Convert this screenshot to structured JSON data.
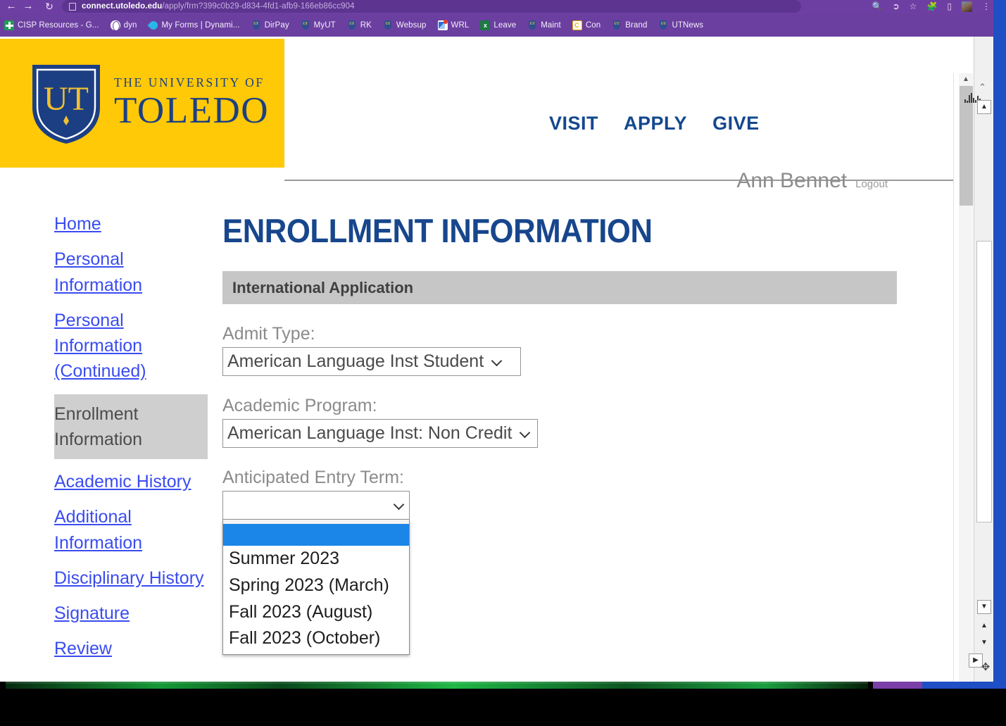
{
  "browser": {
    "nav": {
      "back_icon": "back-arrow-icon",
      "forward_icon": "forward-arrow-icon",
      "reload_icon": "reload-icon"
    },
    "url_host": "connect.utoledo.edu",
    "url_path": "/apply/frm?399c0b29-d834-4fd1-afb9-166eb86cc904",
    "toolbar_icons": [
      "search-icon",
      "share-icon",
      "bookmark-star-icon",
      "extensions-puzzle-icon",
      "sidebar-panel-icon",
      "profile-avatar",
      "browser-menu-icon"
    ],
    "bookmarks": [
      {
        "label": "CISP Resources - G...",
        "icon": "cross-icon"
      },
      {
        "label": "dyn",
        "icon": "globe-icon"
      },
      {
        "label": "My Forms | Dynami...",
        "icon": "dynamics-icon"
      },
      {
        "label": "DirPay",
        "icon": "ut-shield-icon"
      },
      {
        "label": "MyUT",
        "icon": "ut-shield-icon"
      },
      {
        "label": "RK",
        "icon": "ut-shield-icon"
      },
      {
        "label": "Websup",
        "icon": "ut-shield-icon"
      },
      {
        "label": "WRL",
        "icon": "mail-icon"
      },
      {
        "label": "Leave",
        "icon": "excel-icon"
      },
      {
        "label": "Maint",
        "icon": "ut-shield-icon"
      },
      {
        "label": "Con",
        "icon": "calendar-icon"
      },
      {
        "label": "Brand",
        "icon": "ut-shield-icon"
      },
      {
        "label": "UTNews",
        "icon": "ut-shield-icon"
      }
    ]
  },
  "site": {
    "logo": {
      "line1": "THE UNIVERSITY OF",
      "line2": "TOLEDO",
      "monogram": "UT",
      "bg_color": "#ffc907",
      "navy": "#1c3f84"
    },
    "topnav": [
      "VISIT",
      "APPLY",
      "GIVE"
    ],
    "user": {
      "name": "Ann Bennet",
      "logout_label": "Logout"
    }
  },
  "sidebar": {
    "items": [
      {
        "label": "Home",
        "active": false
      },
      {
        "label": "Personal Information",
        "active": false
      },
      {
        "label": "Personal Information (Continued)",
        "active": false
      },
      {
        "label": "Enrollment Information",
        "active": true
      },
      {
        "label": "Academic History",
        "active": false
      },
      {
        "label": "Additional Information",
        "active": false
      },
      {
        "label": "Disciplinary History",
        "active": false
      },
      {
        "label": "Signature",
        "active": false
      },
      {
        "label": "Review",
        "active": false
      }
    ]
  },
  "main": {
    "page_title": "ENROLLMENT INFORMATION",
    "section_header": "International Application",
    "fields": {
      "admit_type": {
        "label": "Admit Type:",
        "value": "American Language Inst Student"
      },
      "academic_program": {
        "label": "Academic Program:",
        "value": "American Language Inst: Non Credit"
      },
      "entry_term": {
        "label": "Anticipated Entry Term:",
        "value": "",
        "open": true,
        "options": [
          "",
          "Summer 2023",
          "Spring 2023 (March)",
          "Fall 2023 (August)",
          "Fall 2023 (October)"
        ],
        "highlighted_index": 0
      }
    }
  },
  "chrome_right": {
    "scroll_up_icon": "scroll-up-icon",
    "scroll_down_icon": "scroll-down-icon",
    "pan_icon": "move-cross-icon",
    "accent_color": "#1f4fc4"
  }
}
